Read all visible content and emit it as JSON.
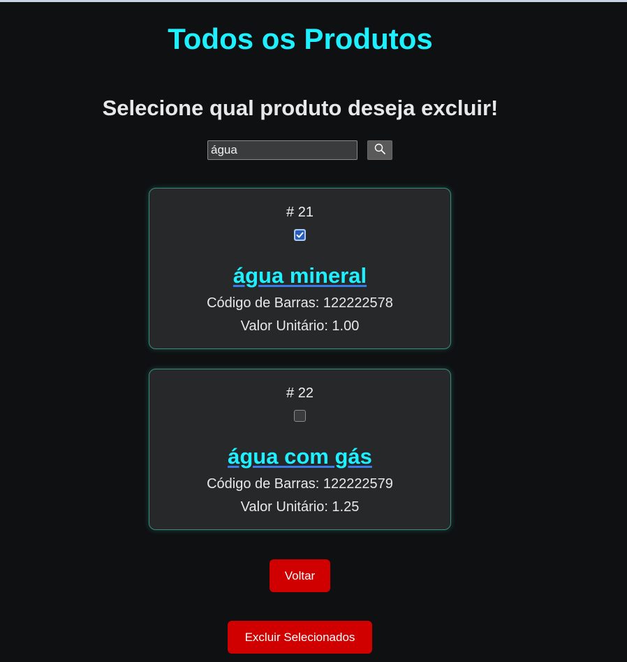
{
  "header": {
    "title": "Todos os Produtos",
    "subtitle": "Selecione qual produto deseja excluir!"
  },
  "search": {
    "value": "água",
    "button_icon": "search-icon"
  },
  "products": [
    {
      "id_label": "# 21",
      "checked": true,
      "name": "água mineral",
      "barcode": "Código de Barras: 122222578",
      "price": "Valor Unitário: 1.00"
    },
    {
      "id_label": "# 22",
      "checked": false,
      "name": "água com gás",
      "barcode": "Código de Barras: 122222579",
      "price": "Valor Unitário: 1.25"
    }
  ],
  "actions": {
    "back_label": "Voltar",
    "delete_label": "Excluir Selecionados"
  },
  "colors": {
    "accent": "#1ff0ff",
    "danger": "#d00000",
    "background": "#0f1012",
    "card": "#262829"
  }
}
